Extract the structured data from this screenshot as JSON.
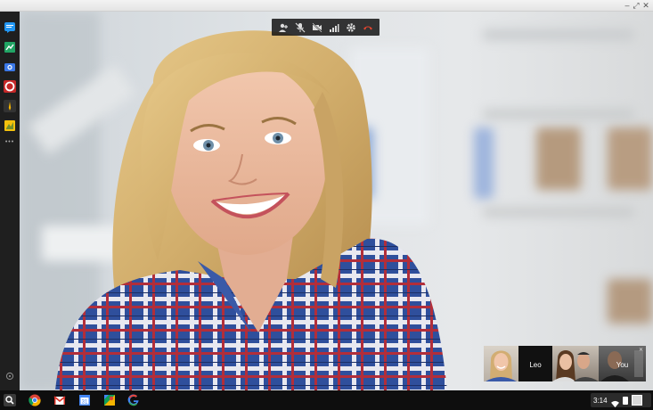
{
  "window": {
    "buttons": {
      "minimize": "–",
      "maximize": "⤢",
      "close": "✕"
    }
  },
  "sidebar": {
    "apps": [
      {
        "icon": "hangouts-icon",
        "color": "#2196f3"
      },
      {
        "icon": "sheets-icon",
        "color": "#21a464"
      },
      {
        "icon": "camera-icon",
        "color": "#3b78e7"
      },
      {
        "icon": "lifebuoy-icon",
        "color": "#d32f2f"
      },
      {
        "icon": "pen-icon",
        "color": "#3a3a3a"
      },
      {
        "icon": "keep-icon",
        "color": "#f4c20d"
      }
    ],
    "more": "•••"
  },
  "call": {
    "toolbar": [
      "add-person-icon",
      "mute-mic-icon",
      "camera-off-icon",
      "signal-icon",
      "settings-icon",
      "hang-up-icon"
    ],
    "participants": [
      {
        "label": ""
      },
      {
        "label": "Leo"
      },
      {
        "label": ""
      },
      {
        "label": "You"
      }
    ]
  },
  "shelf": {
    "apps": [
      "search-icon",
      "chrome-icon",
      "gmail-icon",
      "calendar-icon",
      "maps-icon",
      "google-icon"
    ],
    "time": "3:14",
    "colors": {
      "hangup": "#e0452f",
      "shelf_bg": "#0e0e0e"
    }
  }
}
